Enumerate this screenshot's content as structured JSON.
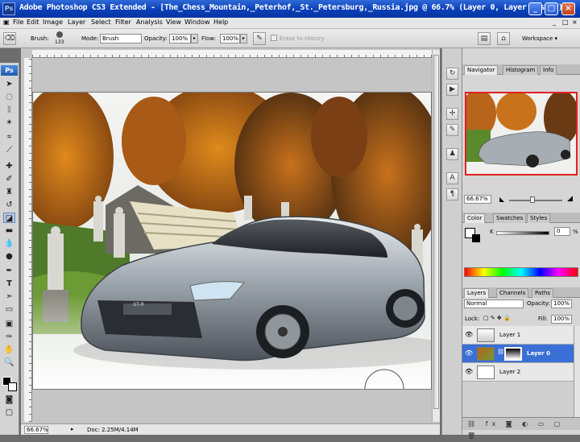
{
  "titlebar": {
    "title": "Adobe Photoshop CS3 Extended - [The_Chess_Mountain,_Peterhof,_St._Petersburg,_Russia.jpg @ 66.7% (Layer 0, Layer Mask/8)]",
    "app_icon": "Ps",
    "buttons": {
      "minimize": "_",
      "maximize": "□",
      "close": "×"
    }
  },
  "menubar": {
    "items": [
      "File",
      "Edit",
      "Image",
      "Layer",
      "Select",
      "Filter",
      "Analysis",
      "View",
      "Window",
      "Help"
    ],
    "doc_min": "_",
    "doc_max": "□",
    "doc_close": "×"
  },
  "options": {
    "brush_label": "Brush:",
    "brush_size": "133",
    "mode_label": "Mode:",
    "mode_value": "Brush",
    "opacity_label": "Opacity:",
    "opacity_value": "100%",
    "flow_label": "Flow:",
    "flow_value": "100%",
    "erase_history_label": "Erase to History",
    "workspace_label": "Workspace ▾"
  },
  "toolbox": {
    "logo": "Ps",
    "tools": [
      "move-tool",
      "marquee-tool",
      "lasso-tool",
      "magic-wand-tool",
      "crop-tool",
      "slice-tool",
      "healing-brush-tool",
      "brush-tool",
      "clone-stamp-tool",
      "history-brush-tool",
      "eraser-tool",
      "gradient-tool",
      "blur-tool",
      "dodge-tool",
      "pen-tool",
      "type-tool",
      "path-selection-tool",
      "shape-tool",
      "notes-tool",
      "eyedropper-tool",
      "hand-tool",
      "zoom-tool"
    ]
  },
  "status": {
    "zoom": "66.67%",
    "doc_info": "Doc: 2.25M/4.14M"
  },
  "navigator": {
    "tabs": [
      "Navigator",
      "Histogram",
      "Info"
    ],
    "active_tab": "Navigator",
    "zoom": "66.67%"
  },
  "color_panel": {
    "tabs": [
      "Color",
      "Swatches",
      "Styles"
    ],
    "active_tab": "Color",
    "channel_label": "K",
    "channel_value": "0",
    "pct": "%"
  },
  "layers_panel": {
    "tabs": [
      "Layers",
      "Channels",
      "Paths"
    ],
    "active_tab": "Layers",
    "blend_mode": "Normal",
    "opacity_label": "Opacity:",
    "opacity_value": "100%",
    "lock_label": "Lock:",
    "fill_label": "Fill:",
    "fill_value": "100%",
    "layers": [
      {
        "name": "Layer 1",
        "visible": true,
        "selected": false
      },
      {
        "name": "Layer 0",
        "visible": true,
        "selected": true
      },
      {
        "name": "Layer 2",
        "visible": true,
        "selected": false
      }
    ]
  },
  "colors": {
    "accent": "#3a6fd6",
    "title_bar": "#0a3fb8"
  }
}
